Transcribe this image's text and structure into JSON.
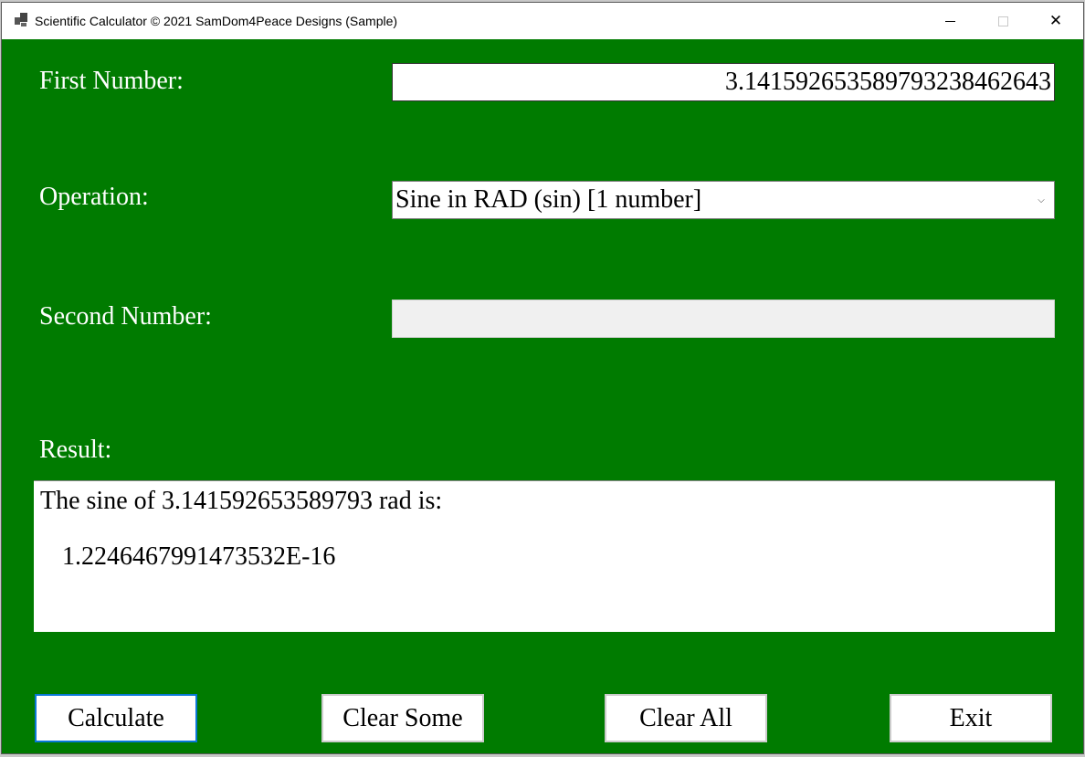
{
  "window": {
    "title": "Scientific Calculator © 2021 SamDom4Peace Designs (Sample)",
    "icon": "app-window-icon",
    "controls": {
      "minimize": "minimize-icon",
      "maximize": "maximize-icon",
      "close": "close-icon"
    },
    "background_color": "#007b00"
  },
  "form": {
    "first_number": {
      "label": "First Number:",
      "value": "3.14159265358979323846264​3"
    },
    "operation": {
      "label": "Operation:",
      "selected": "Sine in RAD (sin) [1 number]"
    },
    "second_number": {
      "label": "Second Number:",
      "value": "",
      "enabled": false
    },
    "result": {
      "label": "Result:",
      "line1": "The sine of 3.141592653589793 rad is:",
      "line2": "1.2246467991473532E-16"
    }
  },
  "buttons": {
    "calculate": "Calculate",
    "clear_some": "Clear Some",
    "clear_all": "Clear All",
    "exit": "Exit"
  }
}
